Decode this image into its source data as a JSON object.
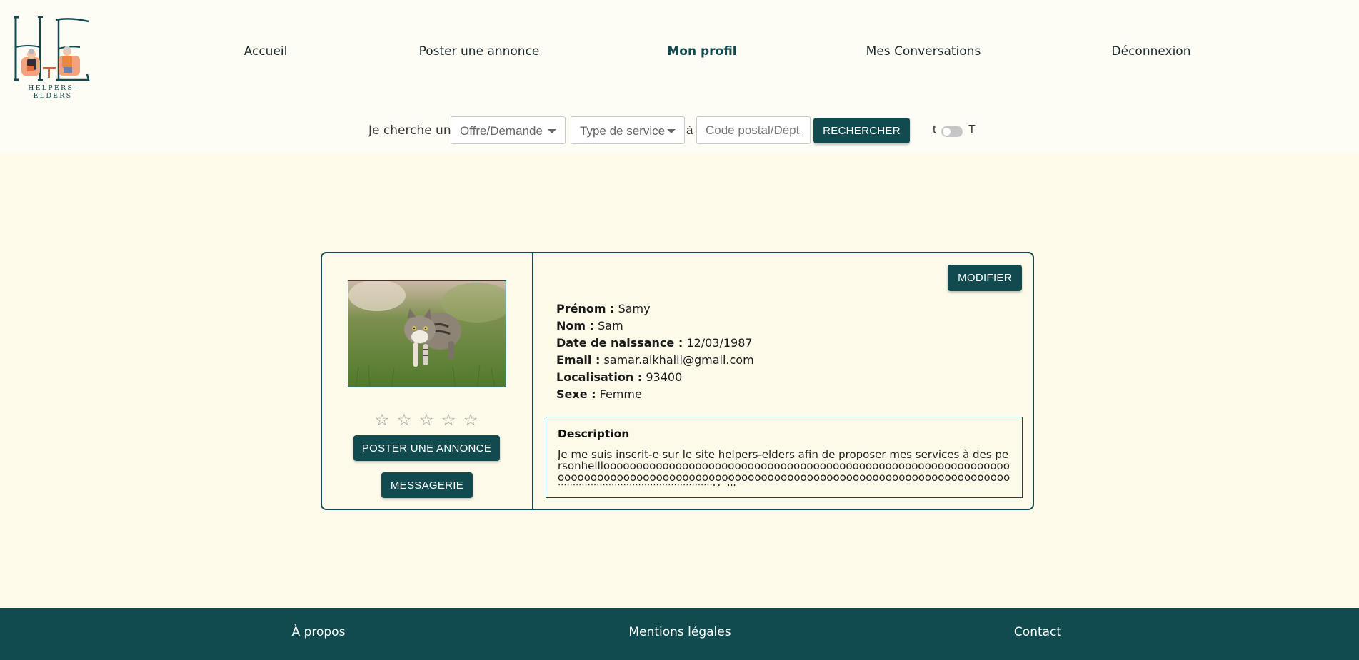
{
  "brand": {
    "name": "HELPERS-ELDERS",
    "monogram": "HE",
    "primary_color": "#124b4f",
    "accent_color": "#e88a5c",
    "background_color": "#fdfaea"
  },
  "nav": {
    "items": [
      {
        "label": "Accueil",
        "active": false
      },
      {
        "label": "Poster une annonce",
        "active": false
      },
      {
        "label": "Mon profil",
        "active": true
      },
      {
        "label": "Mes Conversations",
        "active": false
      },
      {
        "label": "Déconnexion",
        "active": false
      }
    ]
  },
  "search": {
    "prefix": "Je cherche une",
    "offer_select": "Offre/Demande",
    "service_select": "Type de service",
    "connector": "à",
    "postal_placeholder": "Code postal/Dépt.",
    "button": "RECHERCHER",
    "toggle_left": "t",
    "toggle_right": "T",
    "toggle_on": false
  },
  "profile": {
    "edit_button": "MODIFIER",
    "photo_icon": "cat-photo",
    "rating": {
      "value": 0,
      "max": 5,
      "star": "☆"
    },
    "post_button": "POSTER UNE ANNONCE",
    "message_button": "MESSAGERIE",
    "fields": [
      {
        "label": "Prénom :",
        "value": "Samy"
      },
      {
        "label": "Nom :",
        "value": "Sam"
      },
      {
        "label": "Date de naissance :",
        "value": "12/03/1987"
      },
      {
        "label": "Email :",
        "value": "samar.alkhalil@gmail.com"
      },
      {
        "label": "Localisation :",
        "value": "93400"
      },
      {
        "label": "Sexe :",
        "value": "Femme"
      }
    ],
    "description": {
      "title": "Description",
      "text": "Je me suis inscrit-e sur le site helpers-elders afin de proposer mes services à des personhelllooooooooooooooooooooooooooooooooooooooooooooooooooooooooooooooooooooooooooooooooooooooooooooooooooooooooooooooooooooooooooooooooooojjjjjjjjjjjjjjjjjjjjjjjjjjjjjjjjjjjjjjjjjjjjjjjjjjjjHelllooooo"
    }
  },
  "footer": {
    "items": [
      "À propos",
      "Mentions légales",
      "Contact"
    ]
  }
}
